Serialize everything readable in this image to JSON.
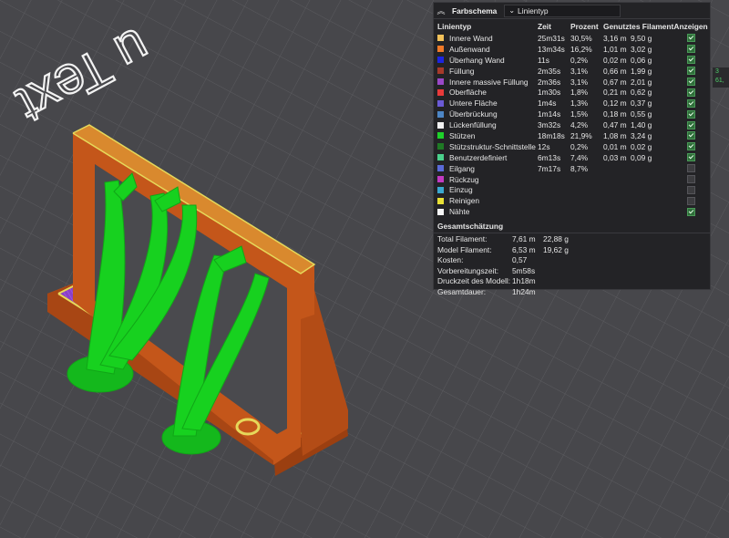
{
  "viewport": {
    "embossed_text": "u Text",
    "colors": {
      "wall": "#c4561a",
      "support": "#17d11f",
      "purple": "#8a3fc9",
      "yellow": "#e6d85a"
    }
  },
  "panel": {
    "collapse_icon": "chevron-up-icon",
    "title": "Farbschema",
    "scheme_value": "Linientyp",
    "columns": {
      "type": "Linientyp",
      "time": "Zeit",
      "percent": "Prozent",
      "filament": "Genutztes Filament",
      "show": "Anzeigen"
    },
    "rows": [
      {
        "label": "Innere Wand",
        "color": "#f2c15a",
        "time": "25m31s",
        "pct": "30,5%",
        "m": "3,16 m",
        "g": "9,50 g",
        "show": true
      },
      {
        "label": "Außenwand",
        "color": "#f07a28",
        "time": "13m34s",
        "pct": "16,2%",
        "m": "1,01 m",
        "g": "3,02 g",
        "show": true
      },
      {
        "label": "Überhang Wand",
        "color": "#1d25e0",
        "time": "11s",
        "pct": "0,2%",
        "m": "0,02 m",
        "g": "0,06 g",
        "show": true
      },
      {
        "label": "Füllung",
        "color": "#a63a2a",
        "time": "2m35s",
        "pct": "3,1%",
        "m": "0,66 m",
        "g": "1,99 g",
        "show": true
      },
      {
        "label": "Innere massive Füllung",
        "color": "#9a48c8",
        "time": "2m36s",
        "pct": "3,1%",
        "m": "0,67 m",
        "g": "2,01 g",
        "show": true
      },
      {
        "label": "Oberfläche",
        "color": "#e83a3a",
        "time": "1m30s",
        "pct": "1,8%",
        "m": "0,21 m",
        "g": "0,62 g",
        "show": true
      },
      {
        "label": "Untere Fläche",
        "color": "#6a5ad6",
        "time": "1m4s",
        "pct": "1,3%",
        "m": "0,12 m",
        "g": "0,37 g",
        "show": true
      },
      {
        "label": "Überbrückung",
        "color": "#4d86c6",
        "time": "1m14s",
        "pct": "1,5%",
        "m": "0,18 m",
        "g": "0,55 g",
        "show": true
      },
      {
        "label": "Lückenfüllung",
        "color": "#f2f2f2",
        "time": "3m32s",
        "pct": "4,2%",
        "m": "0,47 m",
        "g": "1,40 g",
        "show": true
      },
      {
        "label": "Stützen",
        "color": "#1ed12a",
        "time": "18m18s",
        "pct": "21,9%",
        "m": "1,08 m",
        "g": "3,24 g",
        "show": true
      },
      {
        "label": "Stützstruktur-Schnittstelle",
        "color": "#1f7a25",
        "time": "12s",
        "pct": "0,2%",
        "m": "0,01 m",
        "g": "0,02 g",
        "show": true
      },
      {
        "label": "Benutzerdefiniert",
        "color": "#4bd08c",
        "time": "6m13s",
        "pct": "7,4%",
        "m": "0,03 m",
        "g": "0,09 g",
        "show": true
      },
      {
        "label": "Eilgang",
        "color": "#5a6ad8",
        "time": "7m17s",
        "pct": "8,7%",
        "m": "",
        "g": "",
        "show": false
      },
      {
        "label": "Rückzug",
        "color": "#c23ac2",
        "time": "",
        "pct": "",
        "m": "",
        "g": "",
        "show": false
      },
      {
        "label": "Einzug",
        "color": "#3aa8d0",
        "time": "",
        "pct": "",
        "m": "",
        "g": "",
        "show": false
      },
      {
        "label": "Reinigen",
        "color": "#e8e035",
        "time": "",
        "pct": "",
        "m": "",
        "g": "",
        "show": false
      },
      {
        "label": "Nähte",
        "color": "#f5f5f5",
        "time": "",
        "pct": "",
        "m": "",
        "g": "",
        "show": true
      }
    ],
    "summary": {
      "title": "Gesamtschätzung",
      "total_filament": {
        "label": "Total Filament:",
        "m": "7,61 m",
        "g": "22,88 g"
      },
      "model_filament": {
        "label": "Model Filament:",
        "m": "6,53 m",
        "g": "19,62 g"
      },
      "cost": {
        "label": "Kosten:",
        "value": "0,57"
      },
      "prep_time": {
        "label": "Vorbereitungszeit:",
        "value": "5m58s"
      },
      "model_print_time": {
        "label": "Druckzeit des Modell:",
        "value": "1h18m"
      },
      "total_time": {
        "label": "Gesamtdauer:",
        "value": "1h24m"
      }
    }
  },
  "side_chip": {
    "line1": "3",
    "line2": "61,"
  }
}
